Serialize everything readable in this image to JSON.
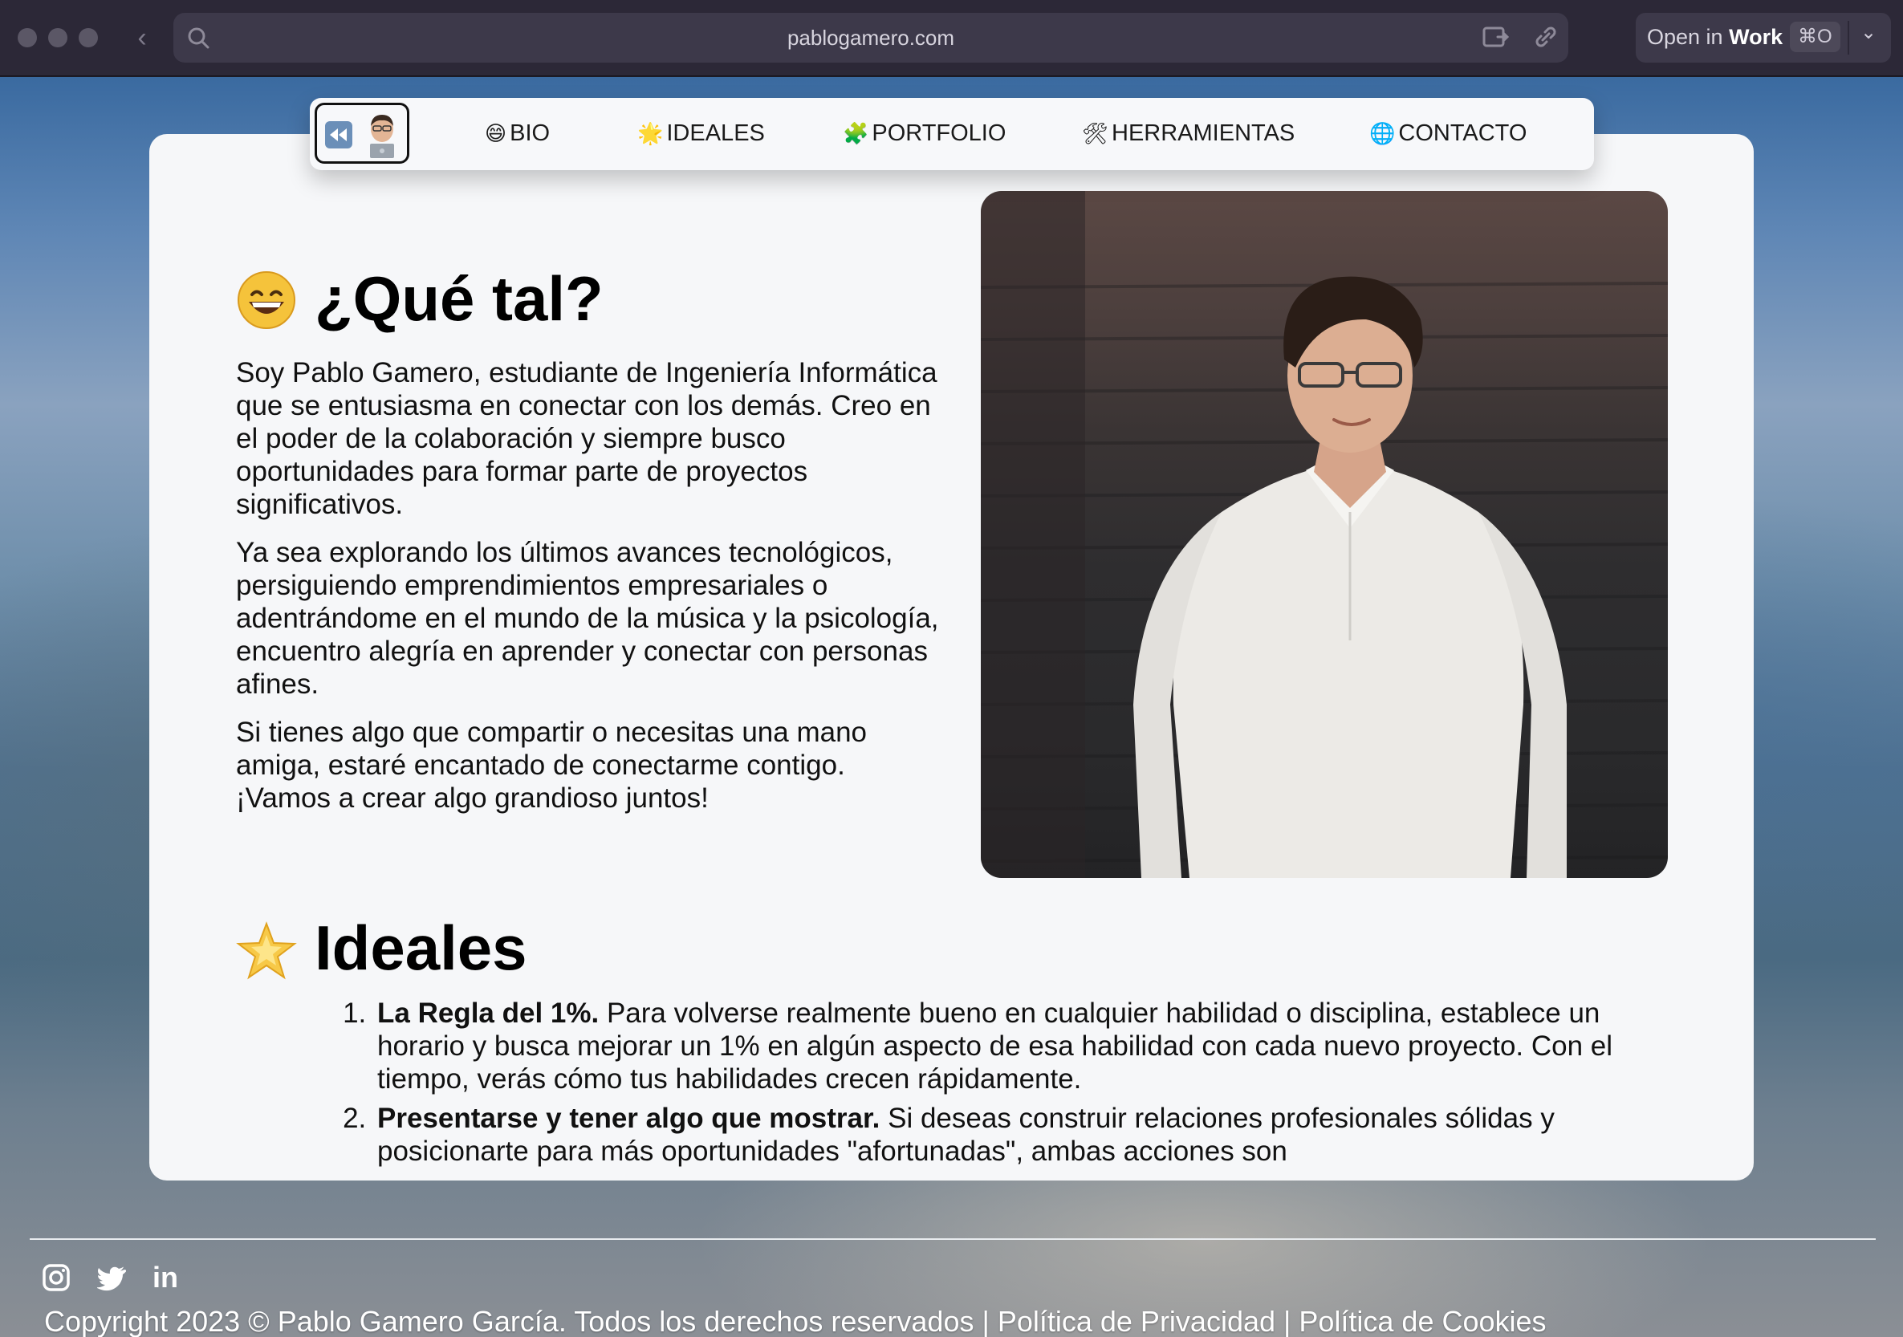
{
  "browser": {
    "url": "pablogamero.com",
    "open_in_prefix": "Open in",
    "open_in_target": "Work",
    "shortcut": "⌘O"
  },
  "nav": {
    "items": [
      {
        "emoji": "😄",
        "label": "BIO"
      },
      {
        "emoji": "🌟",
        "label": "IDEALES"
      },
      {
        "emoji": "🧩",
        "label": "PORTFOLIO"
      },
      {
        "emoji": "🛠",
        "label": "HERRAMIENTAS"
      },
      {
        "emoji": "🌐",
        "label": "CONTACTO"
      }
    ]
  },
  "bio": {
    "title": "¿Qué tal?",
    "paragraphs": [
      "Soy Pablo Gamero, estudiante de Ingeniería Informática que se entusiasma en conectar con los demás. Creo en el poder de la colaboración y siempre busco oportunidades para formar parte de proyectos significativos.",
      "Ya sea explorando los últimos avances tecnológicos, persiguiendo emprendimientos empresariales o adentrándome en el mundo de la música y la psicología, encuentro alegría en aprender y conectar con personas afines.",
      "Si tienes algo que compartir o necesitas una mano amiga, estaré encantado de conectarme contigo. ¡Vamos a crear algo grandioso juntos!"
    ]
  },
  "ideals": {
    "title": "Ideales",
    "items": [
      {
        "bold": "La Regla del 1%.",
        "text": " Para volverse realmente bueno en cualquier habilidad o disciplina, establece un horario y busca mejorar un 1% en algún aspecto de esa habilidad con cada nuevo proyecto. Con el tiempo, verás cómo tus habilidades crecen rápidamente."
      },
      {
        "bold": "Presentarse y tener algo que mostrar.",
        "text": " Si deseas construir relaciones profesionales sólidas y posicionarte para más oportunidades \"afortunadas\", ambas acciones son"
      }
    ]
  },
  "footer": {
    "social": [
      "instagram-icon",
      "twitter-icon",
      "linkedin-icon"
    ],
    "linkedin_text": "in",
    "copyright": "Copyright 2023 © Pablo Gamero García. Todos los derechos reservados | Política de Privacidad | Política de Cookies"
  }
}
